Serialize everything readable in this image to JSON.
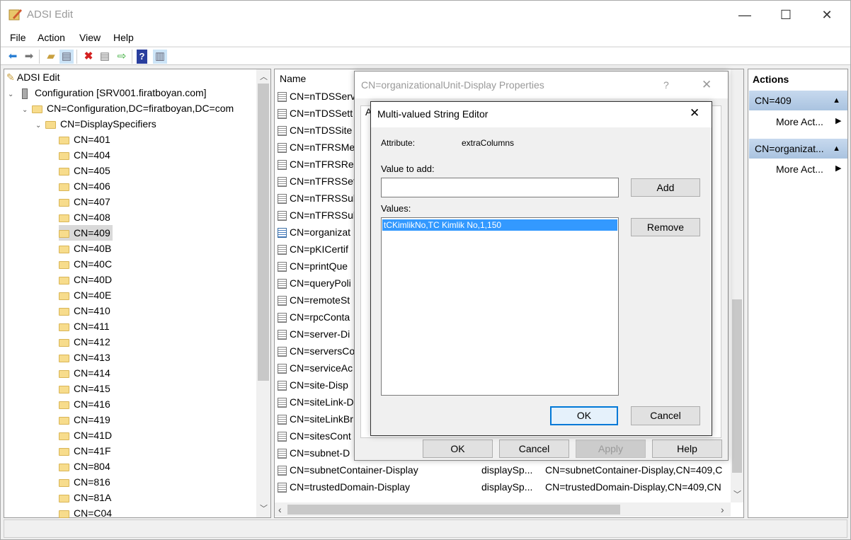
{
  "window": {
    "title": "ADSI Edit",
    "minimize": "—",
    "maximize": "☐",
    "close": "✕"
  },
  "menu": [
    "File",
    "Action",
    "View",
    "Help"
  ],
  "toolbar": [
    "back-icon",
    "forward-icon",
    "up-folder-icon",
    "show-hide-tree-icon",
    "delete-icon",
    "properties-icon",
    "export-icon",
    "help-icon",
    "show-hide-action-pane-icon"
  ],
  "tree": {
    "root": "ADSI Edit",
    "connection": "Configuration [SRV001.firatboyan.com]",
    "naming_context": "CN=Configuration,DC=firatboyan,DC=com",
    "container": "CN=DisplaySpecifiers",
    "items": [
      "CN=401",
      "CN=404",
      "CN=405",
      "CN=406",
      "CN=407",
      "CN=408",
      "CN=409",
      "CN=40B",
      "CN=40C",
      "CN=40D",
      "CN=40E",
      "CN=410",
      "CN=411",
      "CN=412",
      "CN=413",
      "CN=414",
      "CN=415",
      "CN=416",
      "CN=419",
      "CN=41D",
      "CN=41F",
      "CN=804",
      "CN=816",
      "CN=81A",
      "CN=C04"
    ],
    "selected": "CN=409"
  },
  "list": {
    "header_name": "Name",
    "rows": [
      "CN=nTDSServ",
      "CN=nTDSSett",
      "CN=nTDSSite",
      "CN=nTFRSMe",
      "CN=nTFRSRep",
      "CN=nTFRSSet",
      "CN=nTFRSSub",
      "CN=nTFRSSub",
      "CN=organizat",
      "CN=pKICertif",
      "CN=printQue",
      "CN=queryPoli",
      "CN=remoteSt",
      "CN=rpcConta",
      "CN=server-Di",
      "CN=serversCo",
      "CN=serviceAc",
      "CN=site-Disp",
      "CN=siteLink-D",
      "CN=siteLinkBr",
      "CN=sitesCont",
      "CN=subnet-D"
    ],
    "full_rows": [
      {
        "name": "CN=subnetContainer-Display",
        "class": "displaySp...",
        "dn": "CN=subnetContainer-Display,CN=409,C"
      },
      {
        "name": "CN=trustedDomain-Display",
        "class": "displaySp...",
        "dn": "CN=trustedDomain-Display,CN=409,CN"
      }
    ]
  },
  "actions": {
    "title": "Actions",
    "groups": [
      {
        "header": "CN=409",
        "item": "More Act..."
      },
      {
        "header": "CN=organizat...",
        "item": "More Act..."
      }
    ]
  },
  "properties_dialog": {
    "title": "CN=organizationalUnit-Display Properties",
    "help": "?",
    "close": "✕",
    "tab": "A",
    "buttons": {
      "ok": "OK",
      "cancel": "Cancel",
      "apply": "Apply",
      "help": "Help"
    }
  },
  "editor": {
    "title": "Multi-valued String Editor",
    "close": "✕",
    "attribute_label": "Attribute:",
    "attribute_value": "extraColumns",
    "value_to_add_label": "Value to add:",
    "value_to_add": "",
    "add": "Add",
    "values_label": "Values:",
    "values": [
      "tCKimlikNo,TC Kimlik No,1,150"
    ],
    "remove": "Remove",
    "ok": "OK",
    "cancel": "Cancel"
  },
  "colors": {
    "selection": "#3399ff",
    "action_header": "#b9cfe8",
    "default_button": "#0078d7"
  }
}
